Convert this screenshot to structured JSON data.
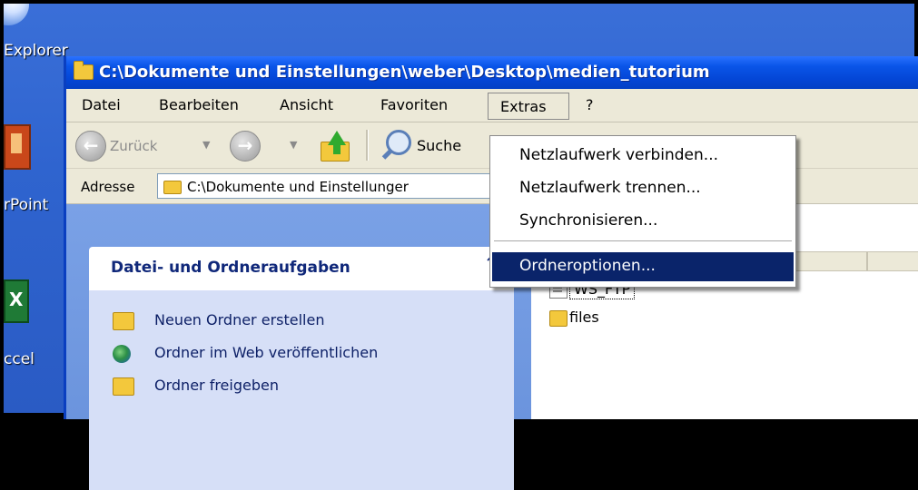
{
  "desktop": {
    "labels": [
      "Explorer",
      "rPoint",
      "ccel"
    ]
  },
  "window": {
    "title": "C:\\Dokumente und Einstellungen\\weber\\Desktop\\medien_tutorium"
  },
  "menubar": {
    "items": [
      "Datei",
      "Bearbeiten",
      "Ansicht",
      "Favoriten",
      "Extras",
      "?"
    ]
  },
  "toolbar": {
    "back_label": "Zurück",
    "search_label": "Suche"
  },
  "address": {
    "label": "Adresse",
    "value": "C:\\Dokumente und Einstellunger"
  },
  "tasks": {
    "title": "Datei- und Ordneraufgaben",
    "collapse_glyph": "⌃",
    "items": [
      "Neuen Ordner erstellen",
      "Ordner im Web veröffentlichen",
      "Ordner freigeben"
    ]
  },
  "files": [
    {
      "name": "WS_FTP",
      "icon": "doc-icon"
    },
    {
      "name": "files",
      "icon": "folder-icon"
    }
  ],
  "extras_menu": {
    "items": [
      "Netzlaufwerk verbinden...",
      "Netzlaufwerk trennen...",
      "Synchronisieren...",
      "Ordneroptionen..."
    ],
    "highlighted": "Ordneroptionen...",
    "highlight_color": "#0a246a"
  }
}
